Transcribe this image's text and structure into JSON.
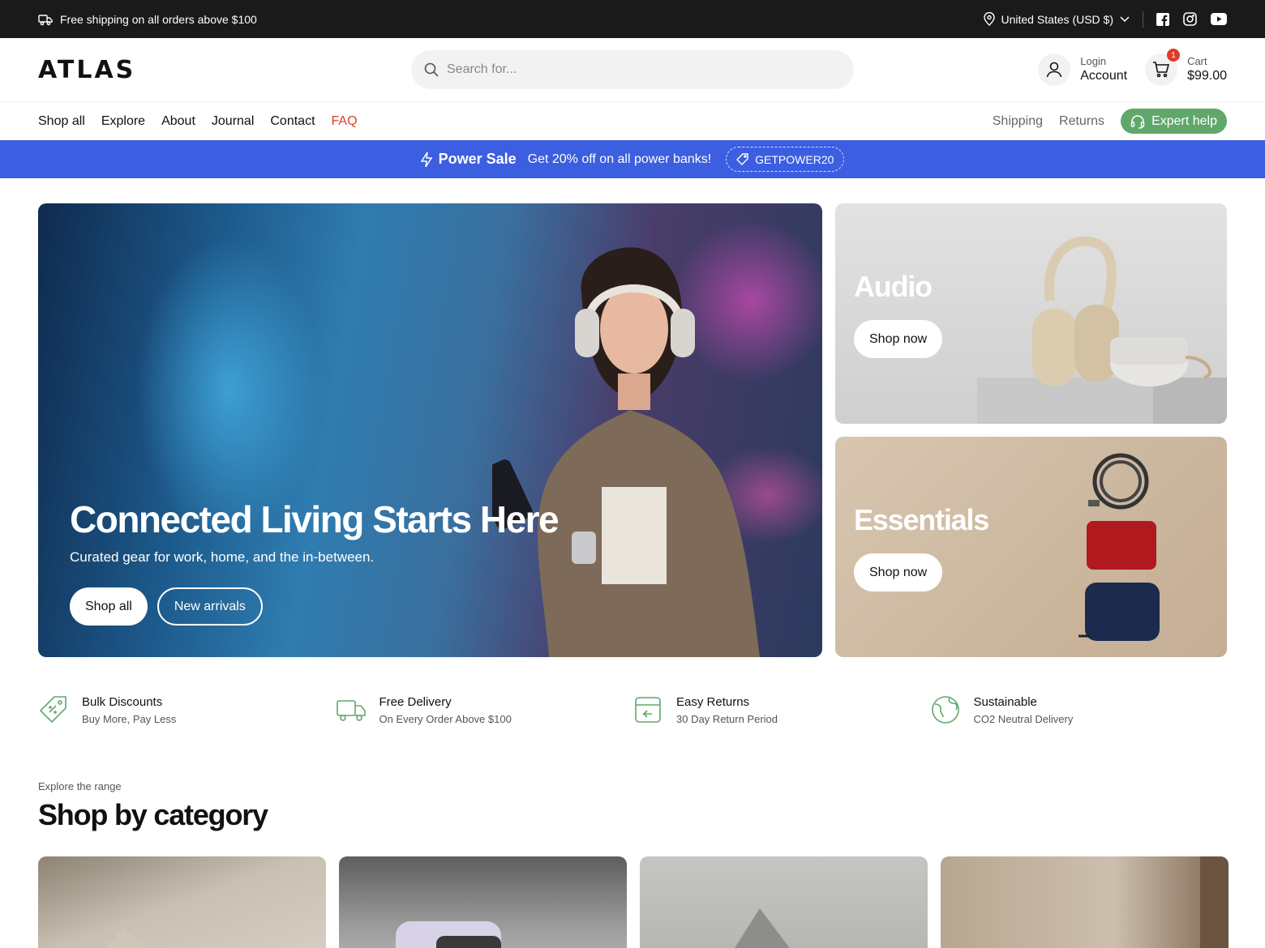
{
  "topbar": {
    "shipping_text": "Free shipping on all orders above $100",
    "region": "United States (USD $)",
    "socials": [
      "facebook-icon",
      "instagram-icon",
      "youtube-icon"
    ]
  },
  "header": {
    "logo": "ATLAS",
    "search_placeholder": "Search for...",
    "account_small": "Login",
    "account_big": "Account",
    "cart_small": "Cart",
    "cart_total": "$99.00",
    "cart_count": "1"
  },
  "nav": {
    "links": [
      "Shop all",
      "Explore",
      "About",
      "Journal",
      "Contact",
      "FAQ"
    ],
    "right": [
      "Shipping",
      "Returns"
    ],
    "expert": "Expert help"
  },
  "promo": {
    "title": "Power Sale",
    "text": "Get 20% off on all power banks!",
    "code": "GETPOWER20",
    "color": "#3c5ee0"
  },
  "hero": {
    "title": "Connected Living Starts Here",
    "subtitle": "Curated gear for work, home, and the in-between.",
    "btn_primary": "Shop all",
    "btn_secondary": "New arrivals"
  },
  "tiles": [
    {
      "title": "Audio",
      "cta": "Shop now"
    },
    {
      "title": "Essentials",
      "cta": "Shop now"
    }
  ],
  "features": [
    {
      "title": "Bulk Discounts",
      "sub": "Buy More, Pay Less",
      "icon": "tag-icon"
    },
    {
      "title": "Free Delivery",
      "sub": "On Every Order Above $100",
      "icon": "truck-icon"
    },
    {
      "title": "Easy Returns",
      "sub": "30 Day Return Period",
      "icon": "return-box-icon"
    },
    {
      "title": "Sustainable",
      "sub": "CO2 Neutral Delivery",
      "icon": "globe-icon"
    }
  ],
  "section": {
    "eyebrow": "Explore the range",
    "title": "Shop by category"
  },
  "colors": {
    "accent_green": "#5fa86a",
    "faq_red": "#d6412b"
  }
}
